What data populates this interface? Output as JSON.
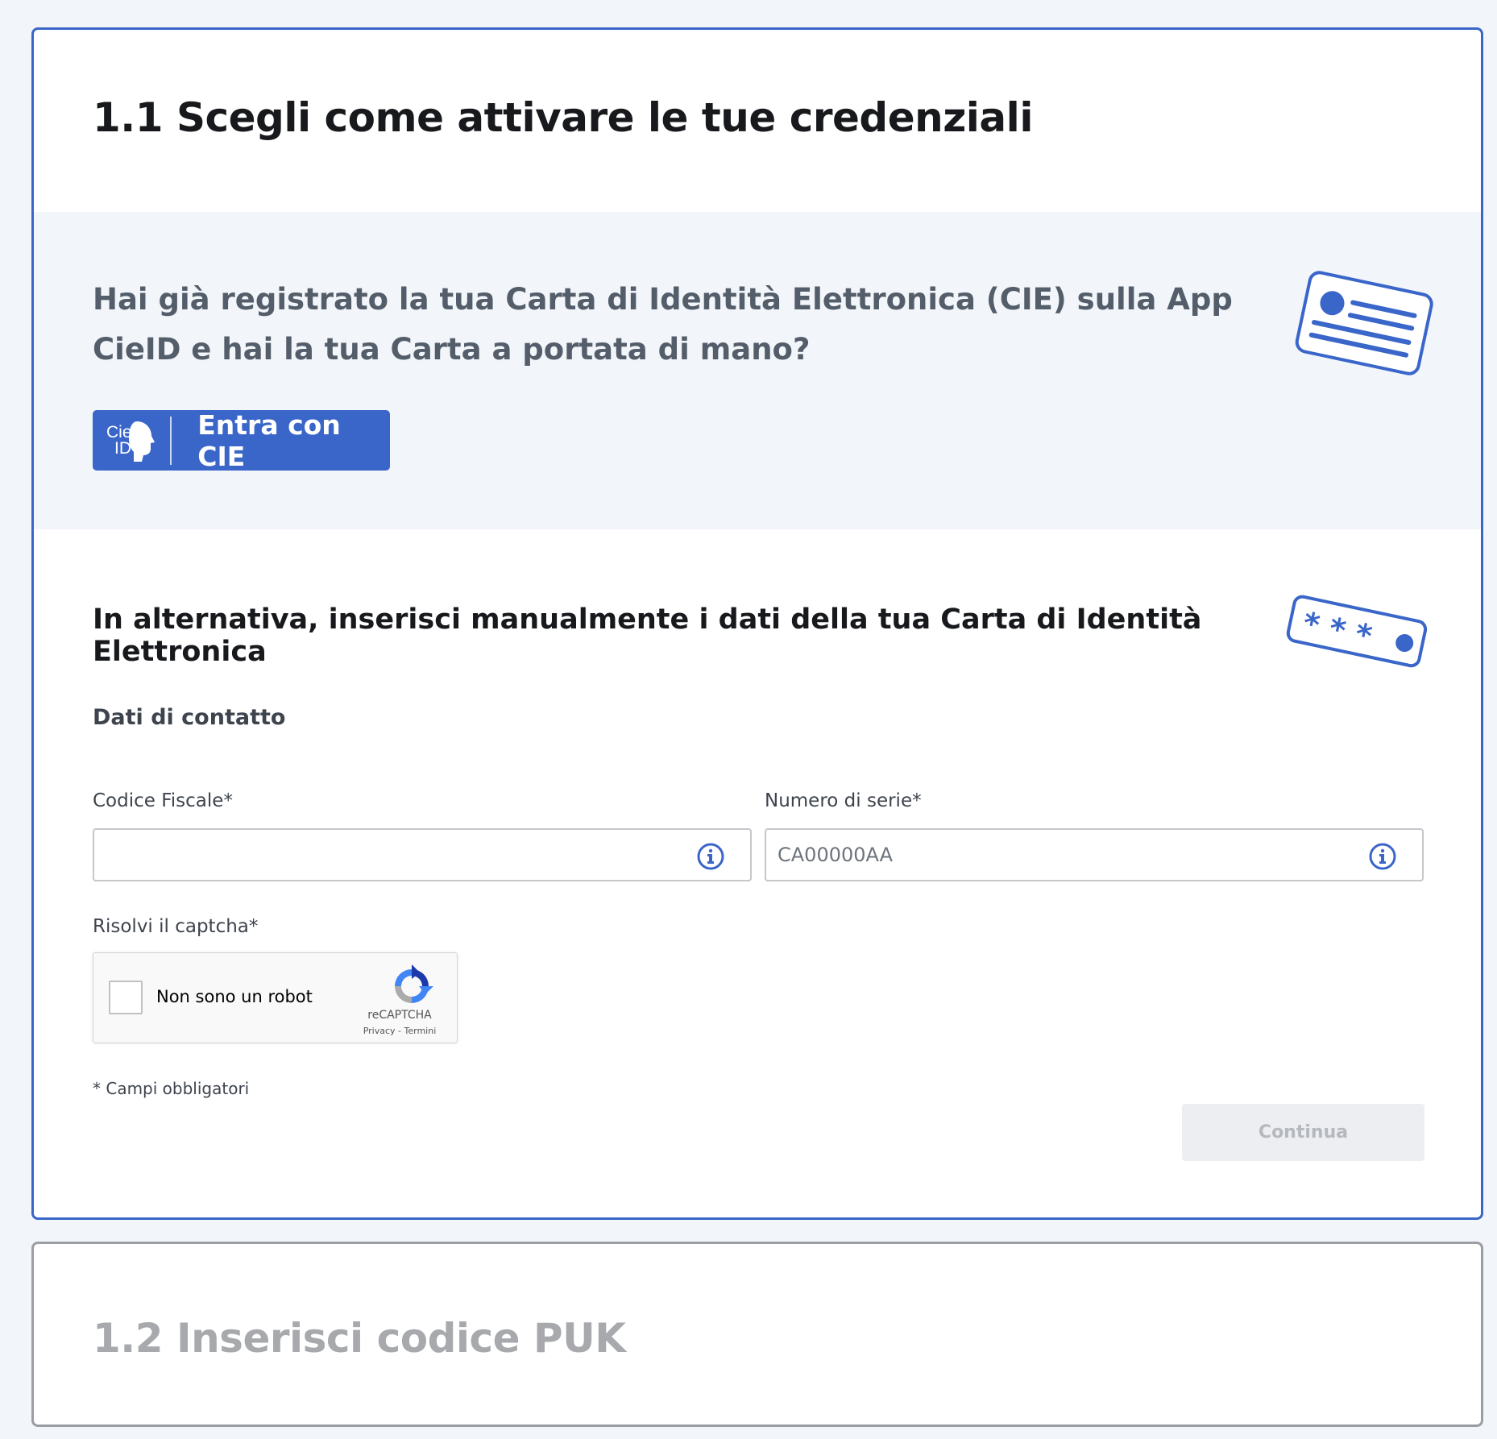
{
  "step1": {
    "title": "1.1 Scegli come attivare le tue credenziali",
    "cie": {
      "question": "Hai già registrato la tua Carta di Identità Elettronica (CIE) sulla App CieID e hai la tua Carta a portata di mano?",
      "logo_line1": "Cie",
      "logo_line2": "ID",
      "button_label": "Entra con CIE",
      "card_icon": "id-card-icon"
    },
    "manual": {
      "title": "In alternativa, inserisci manualmente i dati della tua Carta di Identità Elettronica",
      "pin_icon": "pin-card-icon",
      "section_label": "Dati di contatto",
      "codice_fiscale": {
        "label": "Codice Fiscale*",
        "value": "",
        "placeholder": ""
      },
      "numero_serie": {
        "label": "Numero di serie*",
        "value": "",
        "placeholder": "CA00000AA"
      },
      "captcha": {
        "label": "Risolvi il captcha*",
        "checkbox_label": "Non sono un robot",
        "brand": "reCAPTCHA",
        "links": "Privacy - Termini"
      },
      "required_note": "* Campi obbligatori",
      "continue_label": "Continua"
    }
  },
  "step2": {
    "title": "1.2 Inserisci codice PUK"
  },
  "colors": {
    "accent": "#3a66c9",
    "background": "#f2f6fa",
    "muted_title": "#a7a9ad",
    "disabled_button": "#eceef1"
  }
}
